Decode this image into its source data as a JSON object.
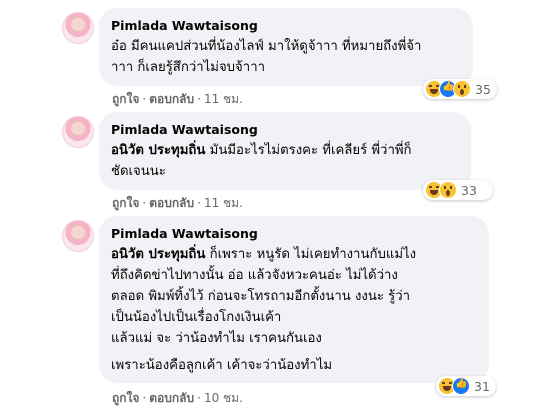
{
  "comments": [
    {
      "author": "Pimlada Wawtaisong",
      "mention": "",
      "lines": [
        "อ๋อ มีคนแคปส่วนที่น้องไลฟ์ มาให้ดูจ้าาา ที่หมายถึงพี่จ้า",
        "าาา ก็เลยรู้สึกว่าไม่จบจ้าาา"
      ],
      "like_label": "ถูกใจ",
      "reply_label": "ตอบกลับ",
      "time": "11 ชม.",
      "reaction_icons": [
        "haha-icon",
        "like-icon",
        "wow-icon"
      ],
      "reaction_count": "35"
    },
    {
      "author": "Pimlada Wawtaisong",
      "mention": "อนิวัต ประทุมถิ่น",
      "lines": [
        "มันมีอะไรไม่ตรงคะ ที่เคลียร์ พี่ว่าพี่ก็",
        "ชัดเจนนะ"
      ],
      "like_label": "ถูกใจ",
      "reply_label": "ตอบกลับ",
      "time": "11 ชม.",
      "reaction_icons": [
        "haha-icon",
        "wow-icon"
      ],
      "reaction_count": "33"
    },
    {
      "author": "Pimlada Wawtaisong",
      "mention": "อนิวัต ประทุมถิ่น",
      "lines": [
        "ก็เพราะ หนูรัด ไม่เคยทำงานกับแม่ไง",
        "ที่ถึงคิดข่าไปทางนั้น อ่อ แล้วจังหวะคนอ่ะ ไม่ได้ว่าง",
        "ตลอด พิมพ์ทิ้งไว้ ก่อนจะโทรถามอีกตั้งนาน งงนะ รู้ว่า",
        "เป็นน้องไปเป็นเรื่องโกงเงินเค้า",
        "แล้วแม่ จะ ว่าน้องทำไม เราคนกันเอง"
      ],
      "extra_line": "เพราะน้องคือลูกเค้า เค้าจะว่าน้องทำไม",
      "like_label": "ถูกใจ",
      "reply_label": "ตอบกลับ",
      "time": "10 ชม.",
      "reaction_icons": [
        "haha-icon",
        "like-icon"
      ],
      "reaction_count": "31"
    }
  ],
  "colors": {
    "bubble": "#f0f2f5",
    "meta": "#65676b",
    "like_blue": "#1877f2",
    "haha_yellow": "#f7c331"
  }
}
